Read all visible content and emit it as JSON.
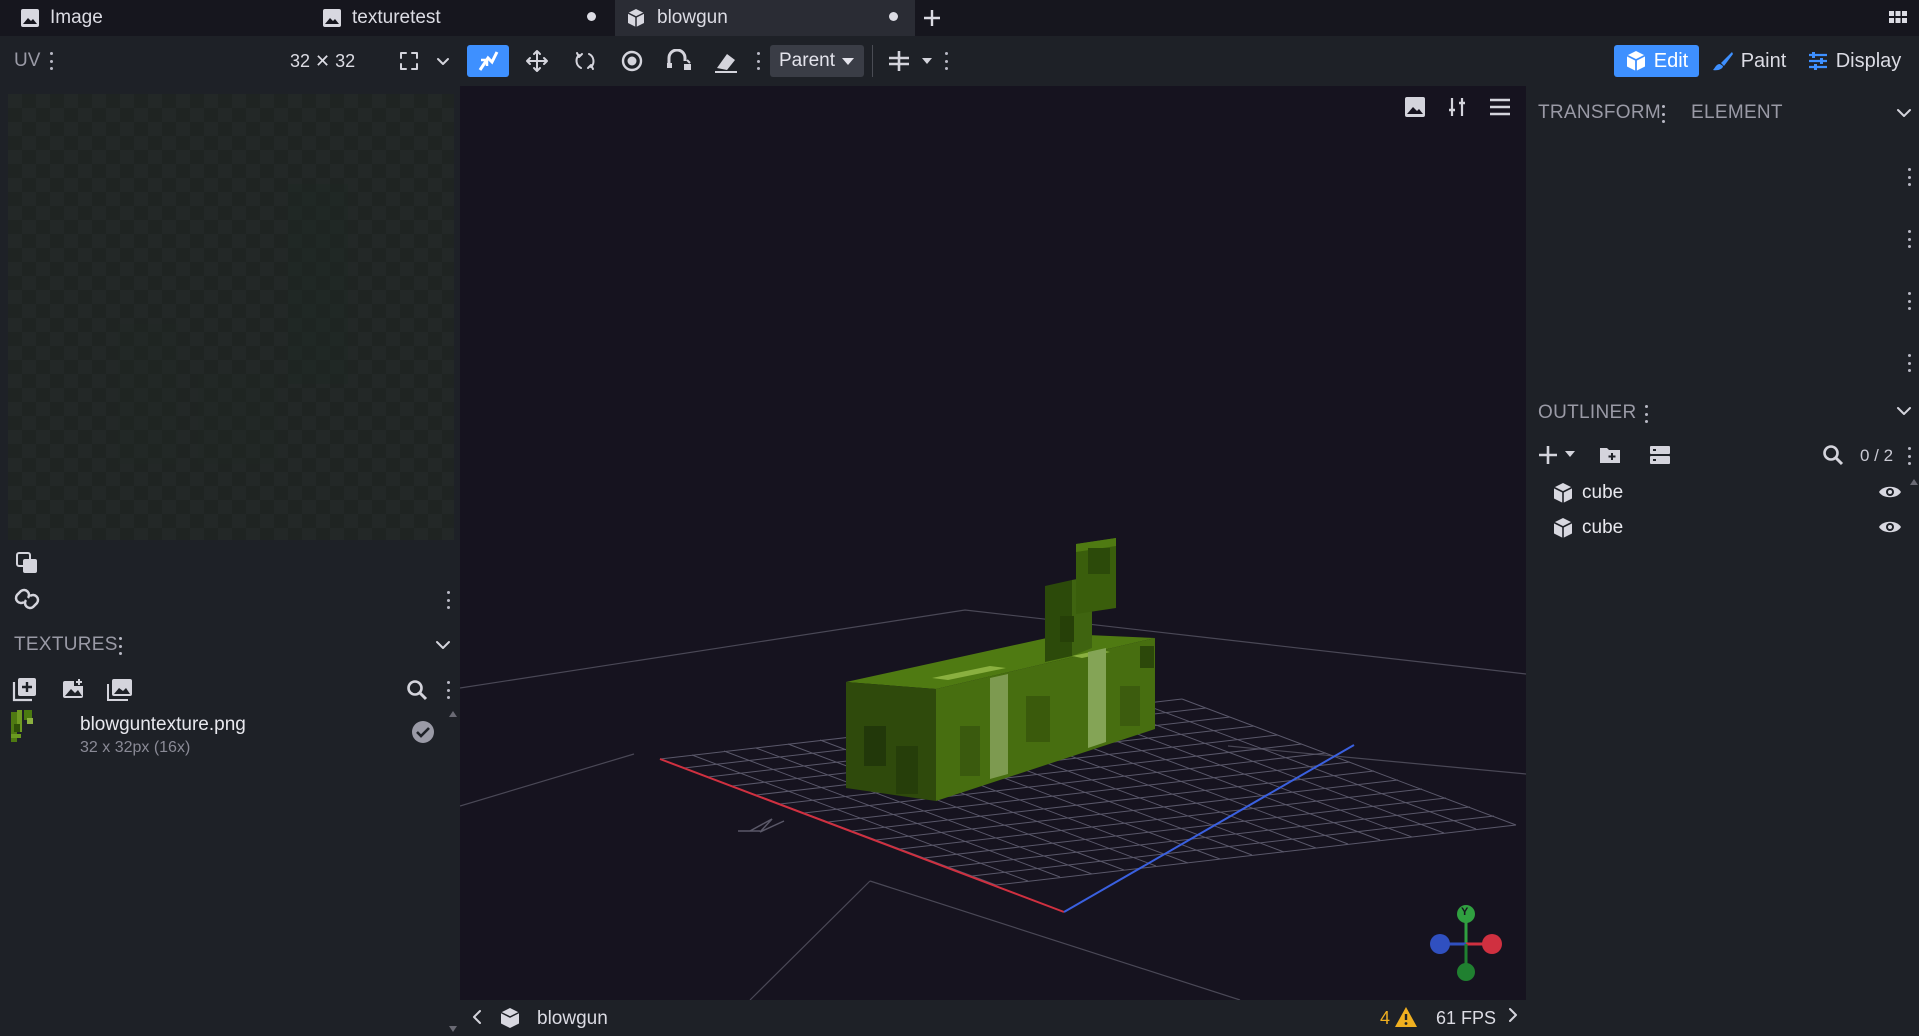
{
  "tabs": [
    {
      "label": "Image",
      "icon": "image-icon"
    },
    {
      "label": "texturetest",
      "icon": "image-icon",
      "unsaved": true
    },
    {
      "label": "blowgun",
      "icon": "model-icon",
      "unsaved": true,
      "active": true
    }
  ],
  "toolbar": {
    "uv_label": "UV",
    "uv_size": "32 ✕ 32",
    "parent_label": "Parent",
    "modes": {
      "edit": "Edit",
      "paint": "Paint",
      "display": "Display"
    }
  },
  "textures": {
    "title": "TEXTURES",
    "items": [
      {
        "name": "blowguntexture.png",
        "info": "32 x 32px (16x)"
      }
    ]
  },
  "viewport": {
    "model_name": "blowgun",
    "warnings": "4",
    "fps": "61 FPS",
    "gizmo_y_label": "Y"
  },
  "panels": {
    "transform": "TRANSFORM",
    "element": "ELEMENT",
    "outliner": "OUTLINER",
    "outliner_count": "0 / 2"
  },
  "outliner": {
    "items": [
      {
        "name": "cube"
      },
      {
        "name": "cube"
      }
    ]
  },
  "colors": {
    "accent": "#3e90ff",
    "viewport_bg": "#16131f",
    "model_green": "#4a6b10",
    "axis_x": "#d03040",
    "axis_z": "#3a60e0"
  }
}
